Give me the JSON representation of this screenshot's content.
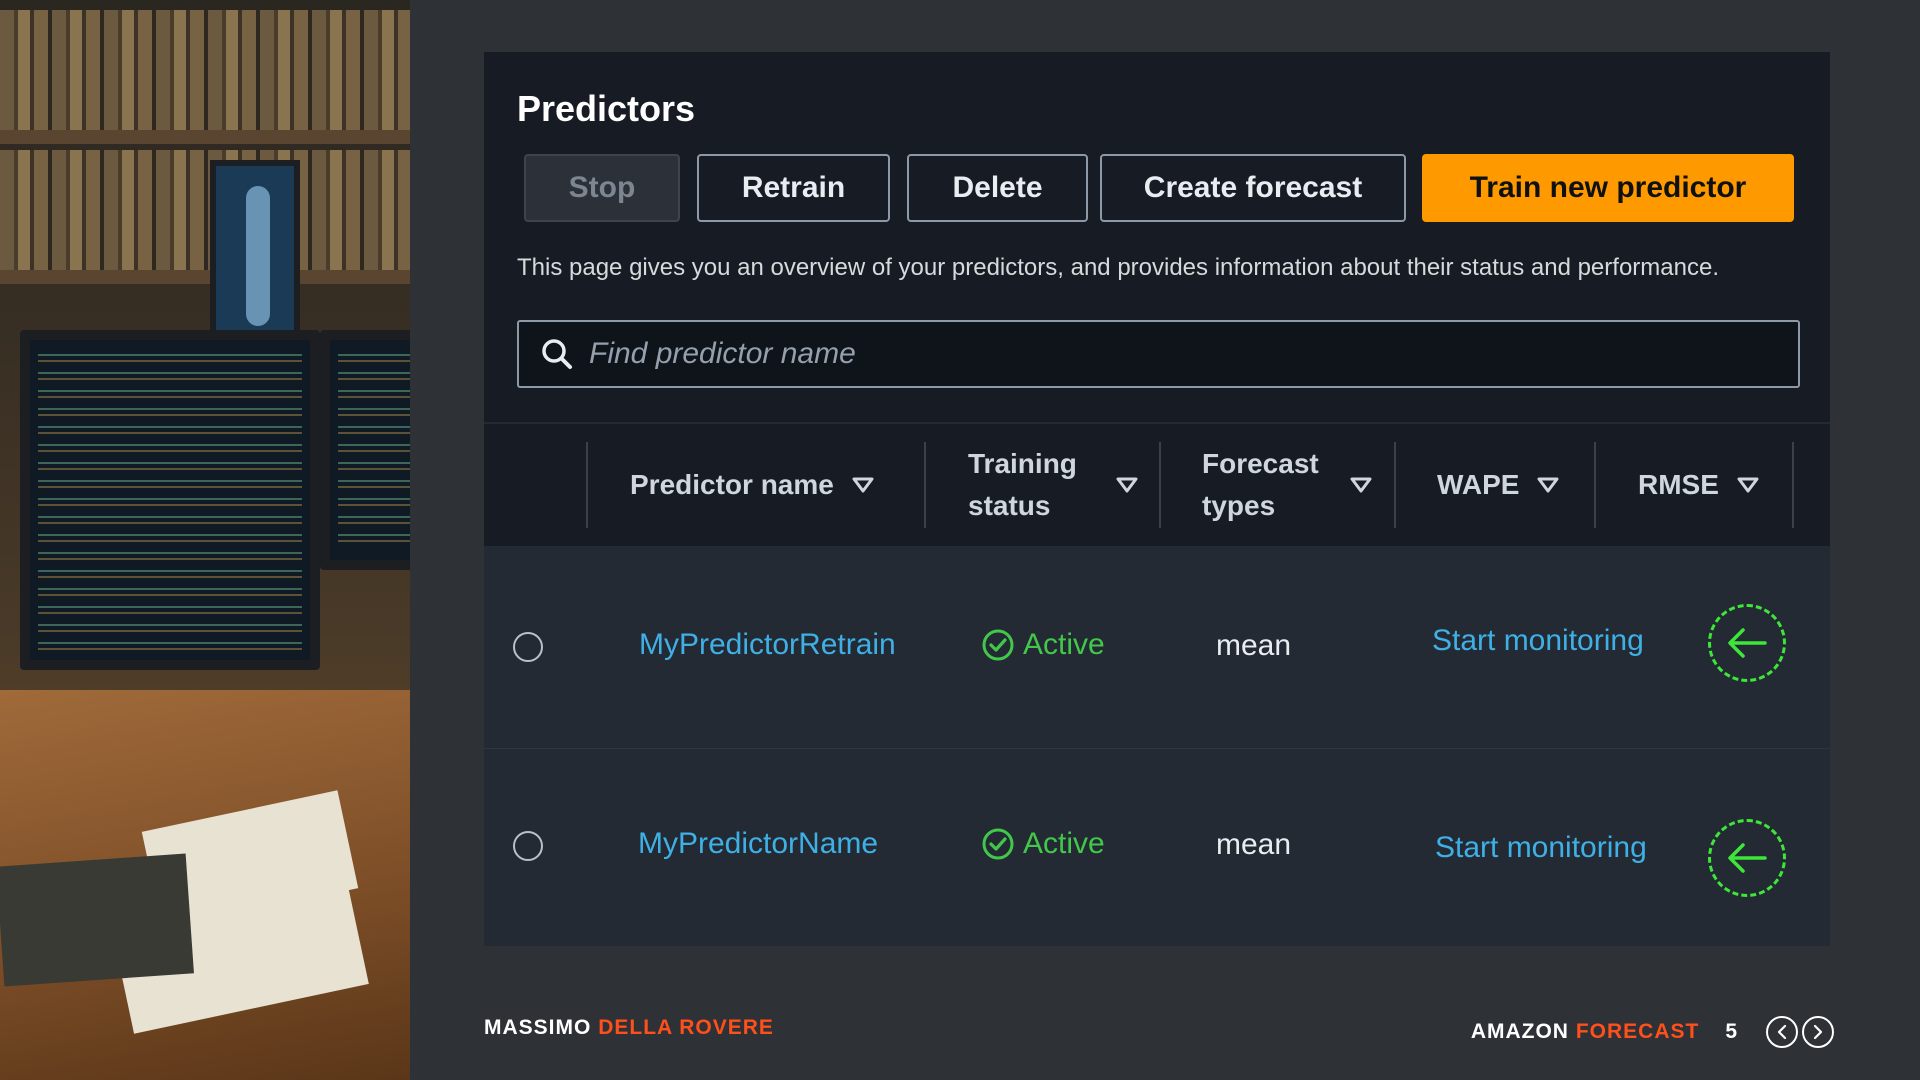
{
  "page": {
    "title": "Predictors",
    "description": "This page gives you an overview of your predictors, and provides information about their status and performance."
  },
  "toolbar": {
    "stop_label": "Stop",
    "retrain_label": "Retrain",
    "delete_label": "Delete",
    "create_forecast_label": "Create forecast",
    "train_new_label": "Train new predictor"
  },
  "search": {
    "placeholder": "Find predictor name"
  },
  "table": {
    "columns": [
      {
        "label": "Predictor name"
      },
      {
        "label": "Training status"
      },
      {
        "label": "Forecast types"
      },
      {
        "label": "WAPE"
      },
      {
        "label": "RMSE"
      }
    ],
    "rows": [
      {
        "name": "MyPredictorRetrain",
        "status": "Active",
        "forecast_type": "mean",
        "monitoring": "Start monitoring"
      },
      {
        "name": "MyPredictorName",
        "status": "Active",
        "forecast_type": "mean",
        "monitoring": "Start monitoring"
      }
    ]
  },
  "footer": {
    "author_first": "MASSIMO",
    "author_last": "DELLA ROVERE",
    "product_first": "AMAZON",
    "product_second": "FORECAST",
    "page_number": "5"
  },
  "colors": {
    "primary": "#ff9900",
    "link": "#3fb0e6",
    "success": "#42c74a",
    "accent": "#ff4f1a",
    "annotation": "#3ee63a"
  },
  "icons": [
    "search-icon",
    "caret-down-icon",
    "check-circle-icon",
    "arrow-left-icon",
    "chevron-left-icon",
    "chevron-right-icon"
  ]
}
